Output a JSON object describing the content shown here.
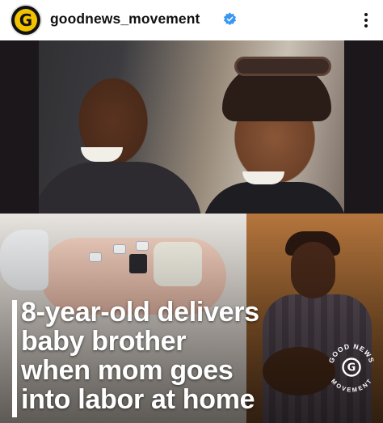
{
  "header": {
    "avatar_letter": "G",
    "username": "goodnews_movement",
    "verified_icon": "verified-badge-icon",
    "more_icon": "more-options-icon"
  },
  "post": {
    "headline_lines": [
      "8-year-old delivers",
      "baby brother",
      "when mom goes",
      "into labor at home"
    ],
    "watermark": {
      "top_text": "GOOD NEWS",
      "bottom_text": "MOVEMENT",
      "letter": "G"
    }
  },
  "colors": {
    "brand_yellow": "#f2c200",
    "verified_blue": "#3897f0",
    "headline_text": "#ffffff"
  }
}
